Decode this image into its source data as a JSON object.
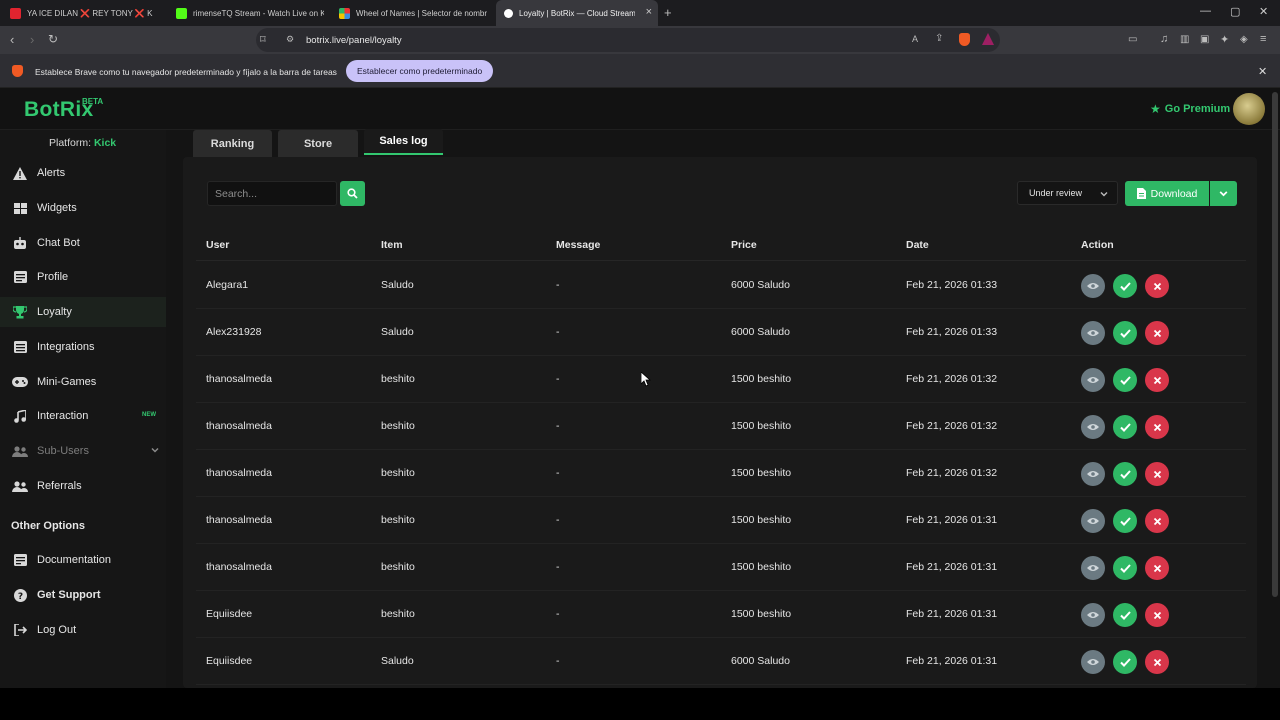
{
  "browser": {
    "tabs": [
      {
        "title": "YA ICE DILAN ❌ REY TONY ❌ K",
        "favicon_color": "#e0242f"
      },
      {
        "title": "rimenseTQ Stream - Watch Live on Ki",
        "favicon_color": "#53fc18"
      },
      {
        "title": "Wheel of Names | Selector de nombr",
        "favicon_color": "#3a8de0"
      },
      {
        "title": "Loyalty | BotRix — Cloud Stream",
        "favicon_color": "#ffffff"
      }
    ],
    "url": "botrix.live/panel/loyalty"
  },
  "infobar": {
    "message": "Establece Brave como tu navegador predeterminado y fíjalo a la barra de tareas",
    "button_label": "Establecer como predeterminado"
  },
  "app": {
    "logo": "BotRix",
    "beta": "BETA",
    "premium_label": "Go Premium",
    "platform_label": "Platform:",
    "platform_value": "Kick",
    "accent": "#33c870"
  },
  "sidebar": {
    "items": [
      {
        "label": "Alerts",
        "icon": "warning-icon"
      },
      {
        "label": "Widgets",
        "icon": "grid-icon"
      },
      {
        "label": "Chat Bot",
        "icon": "robot-icon"
      },
      {
        "label": "Profile",
        "icon": "id-card-icon"
      },
      {
        "label": "Loyalty",
        "icon": "trophy-icon",
        "active": true
      },
      {
        "label": "Integrations",
        "icon": "list-icon"
      },
      {
        "label": "Mini-Games",
        "icon": "gamepad-icon"
      },
      {
        "label": "Interaction",
        "icon": "music-note-icon",
        "badge": "NEW"
      },
      {
        "label": "Sub-Users",
        "icon": "users-icon",
        "disabled": true
      },
      {
        "label": "Referrals",
        "icon": "users-icon"
      }
    ],
    "other_header": "Other Options",
    "other_items": [
      {
        "label": "Documentation",
        "icon": "document-icon"
      },
      {
        "label": "Get Support",
        "icon": "question-icon"
      },
      {
        "label": "Log Out",
        "icon": "logout-icon"
      }
    ]
  },
  "page_tabs": [
    "Ranking",
    "Store",
    "Sales log"
  ],
  "active_tab": "Sales log",
  "toolbar": {
    "search_placeholder": "Search...",
    "filter_value": "Under review",
    "download_label": "Download"
  },
  "table": {
    "headers": [
      "User",
      "Item",
      "Message",
      "Price",
      "Date",
      "Action"
    ],
    "rows": [
      {
        "user": "Alegara1",
        "item": "Saludo",
        "message": "-",
        "price": "6000 Saludo",
        "date": "Feb 21, 2026 01:33"
      },
      {
        "user": "Alex231928",
        "item": "Saludo",
        "message": "-",
        "price": "6000 Saludo",
        "date": "Feb 21, 2026 01:33"
      },
      {
        "user": "thanosalmeda",
        "item": "beshito",
        "message": "-",
        "price": "1500 beshito",
        "date": "Feb 21, 2026 01:32"
      },
      {
        "user": "thanosalmeda",
        "item": "beshito",
        "message": "-",
        "price": "1500 beshito",
        "date": "Feb 21, 2026 01:32"
      },
      {
        "user": "thanosalmeda",
        "item": "beshito",
        "message": "-",
        "price": "1500 beshito",
        "date": "Feb 21, 2026 01:32"
      },
      {
        "user": "thanosalmeda",
        "item": "beshito",
        "message": "-",
        "price": "1500 beshito",
        "date": "Feb 21, 2026 01:31"
      },
      {
        "user": "thanosalmeda",
        "item": "beshito",
        "message": "-",
        "price": "1500 beshito",
        "date": "Feb 21, 2026 01:31"
      },
      {
        "user": "Equiisdee",
        "item": "beshito",
        "message": "-",
        "price": "1500 beshito",
        "date": "Feb 21, 2026 01:31"
      },
      {
        "user": "Equiisdee",
        "item": "Saludo",
        "message": "-",
        "price": "6000 Saludo",
        "date": "Feb 21, 2026 01:31"
      }
    ]
  }
}
